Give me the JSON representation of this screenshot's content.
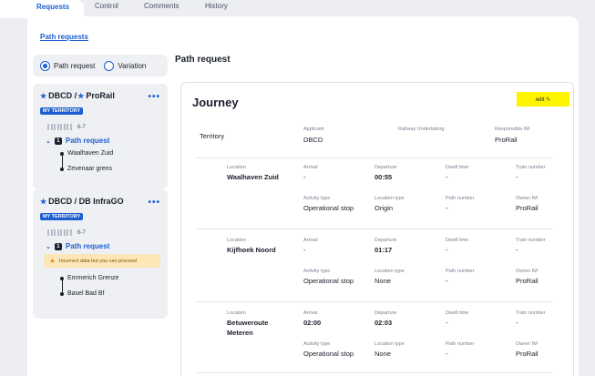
{
  "tabs": [
    "Requests",
    "Control",
    "Comments",
    "History"
  ],
  "path_requests_link": "Path requests",
  "toggle": {
    "opt1": "Path request",
    "opt2": "Variation"
  },
  "cards": [
    {
      "title": "DBCD / ",
      "title2": "ProRail",
      "badge": "MY TERRITORY",
      "more": "•••",
      "days": "6-7",
      "pr_num": "1",
      "pr_label": "Path request",
      "stops": [
        "Waalhaven Zuid",
        "Zevenaar grens"
      ]
    },
    {
      "title": "DBCD / DB InfraGO",
      "badge": "MY TERRITORY",
      "more": "•••",
      "days": "6-7",
      "pr_num": "1",
      "pr_label": "Path request",
      "warning": "Incorrect data but you can proceed",
      "stops": [
        "Emmerich Grenze",
        "Basel Bad Bf"
      ]
    }
  ],
  "main_title": "Path request",
  "journey": {
    "title": "Journey",
    "edit": "edit ✎",
    "territory_label": "Territory",
    "applicant_label": "Applicant",
    "applicant": "DBCD",
    "ru_label": "Railway Undertaking",
    "im_label": "Responsible IM",
    "im": "ProRail",
    "locations": [
      {
        "location_label": "Location",
        "location": "Waalhaven Zuid",
        "arrival": "-",
        "departure": "00:55",
        "dwell": "-",
        "train": "-",
        "activity": "Operational stop",
        "loctype": "Origin",
        "path": "-",
        "owner": "ProRail"
      },
      {
        "location_label": "Location",
        "location": "Kijfhoek Noord",
        "arrival": "-",
        "departure": "01:17",
        "dwell": "-",
        "train": "-",
        "activity": "Operational stop",
        "loctype": "None",
        "path": "-",
        "owner": "ProRail"
      },
      {
        "location_label": "Location",
        "location": "Betuweroute",
        "location2": "Meteren",
        "arrival": "02:00",
        "departure": "02:03",
        "dwell": "-",
        "train": "-",
        "activity": "Operational stop",
        "loctype": "None",
        "path": "-",
        "owner": "ProRail"
      }
    ],
    "labels": {
      "arrival": "Arrival",
      "departure": "Departure",
      "dwell": "Dwell time",
      "train": "Train number",
      "activity": "Activity type",
      "loctype": "Location type",
      "path": "Path number",
      "owner": "Owner IM"
    }
  },
  "colors": {
    "accent": "#1d5fd1",
    "highlight": "#fff400"
  }
}
